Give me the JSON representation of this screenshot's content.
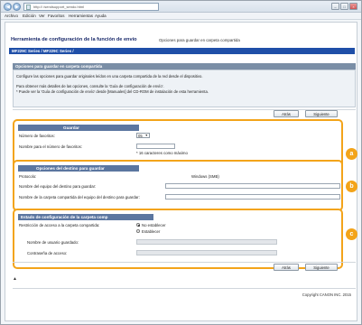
{
  "browser": {
    "url": "http://            /sendsupport_sendo.html",
    "back_glyph": "◀",
    "forward_glyph": "▶",
    "window_controls": [
      "–",
      "□",
      "×"
    ],
    "menu": [
      "Archivo",
      "Edición",
      "Ver",
      "Favoritos",
      "Herramientas",
      "Ayuda"
    ]
  },
  "header": {
    "title": "Herramienta de configuración de la función de envío",
    "subtitle": "Opciones para guardar en carpeta compartida",
    "breadcrumb": "MF229C Series / MF229C Series /"
  },
  "intro": {
    "heading": "Opciones para guardar en carpeta compartida",
    "lines": [
      "Configure las opciones para guardar originales leídos en una carpeta compartida de la red desde el dispositivo.",
      "Para obtener más detalles de las opciones, consulte la 'Guía de configuración de envío'.",
      "* Puede ver la 'Guía de configuración de envío' desde [Manuales] del CD-ROM de instalación de esta herramienta."
    ]
  },
  "buttons": {
    "back": "Atrás",
    "next": "Siguiente"
  },
  "section_a": {
    "heading": "Guardar",
    "number_label": "Número de favoritos:",
    "number_value": "05",
    "name_label": "Nombre para el número de favoritos:",
    "name_value": "",
    "name_hint": "* 16 caracteres como máximo",
    "callout": "a"
  },
  "section_b": {
    "heading": "Opciones del destino para guardar",
    "protocol_label": "Protocolo:",
    "protocol_value": "Windows (SMB)",
    "computer_label": "Nombre del equipo del destino para guardar:",
    "computer_value": "",
    "folder_label": "Nombre de la carpeta compartida del equipo del destino para guardar:",
    "folder_value": "",
    "callout": "b"
  },
  "section_c": {
    "heading": "Estado de configuración de la carpeta comp",
    "restriction_label": "Restricción de acceso a la carpeta compartida:",
    "option_none": "No establecer",
    "option_set": "Establecer",
    "selected": "No establecer",
    "username_label": "Nombre de usuario guardado:",
    "password_label": "Contraseña de acceso:",
    "callout": "c"
  },
  "footer": {
    "top_link": "▲",
    "copyright": "Copyright CANON INC. 2015"
  },
  "colors": {
    "accent_orange": "#f3a41a",
    "title_navy": "#1a2a6b",
    "bar_blue": "#1f4fa8",
    "section_head": "#5b76a0"
  }
}
